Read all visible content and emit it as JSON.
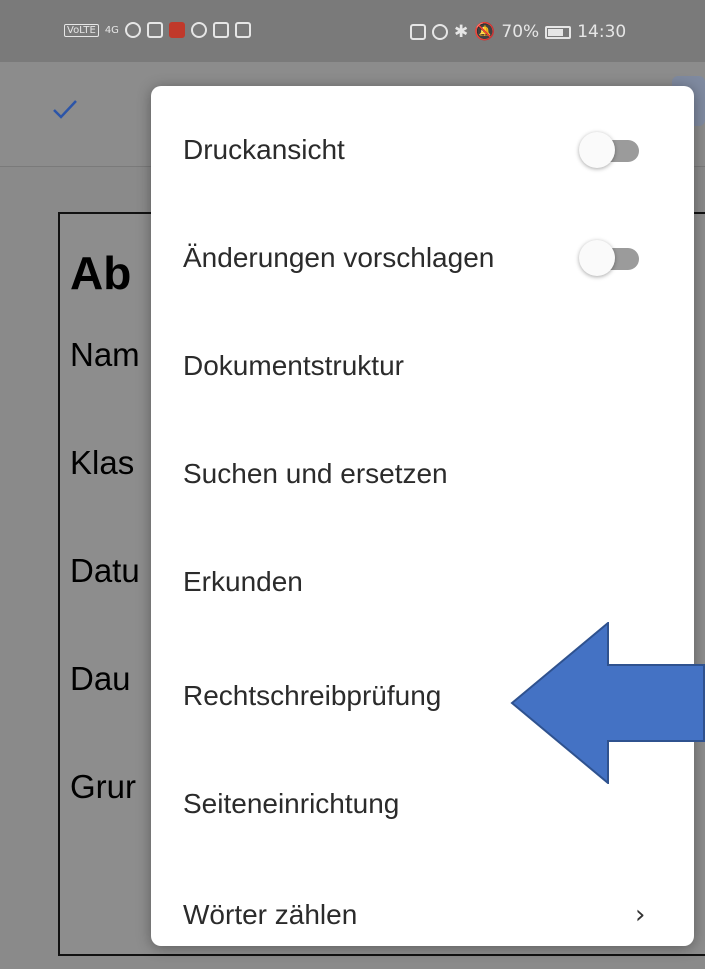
{
  "status_bar": {
    "left_lte": "VoLTE",
    "left_signal": "4G",
    "right_battery": "70%",
    "right_time": "14:30"
  },
  "document": {
    "title": "Ab",
    "lines": [
      "Nam",
      "Klas",
      "Datu",
      "Dau",
      "Grur"
    ]
  },
  "menu": {
    "items": [
      {
        "label": "Druckansicht",
        "control": "toggle",
        "state": "off"
      },
      {
        "label": "Änderungen vorschlagen",
        "control": "toggle",
        "state": "off"
      },
      {
        "label": "Dokumentstruktur"
      },
      {
        "label": "Suchen und ersetzen"
      },
      {
        "label": "Erkunden"
      },
      {
        "label": "Rechtschreibprüfung"
      },
      {
        "label": "Seiteneinrichtung"
      },
      {
        "label": "Wörter zählen",
        "control": "chevron"
      }
    ],
    "chevron_glyph": "›"
  },
  "colors": {
    "accent": "#1a73e8",
    "annotation_arrow": "#4472c4",
    "annotation_arrow_border": "#2f528f"
  },
  "icons": {
    "check": "check-icon",
    "chevron": "chevron-right-icon"
  }
}
